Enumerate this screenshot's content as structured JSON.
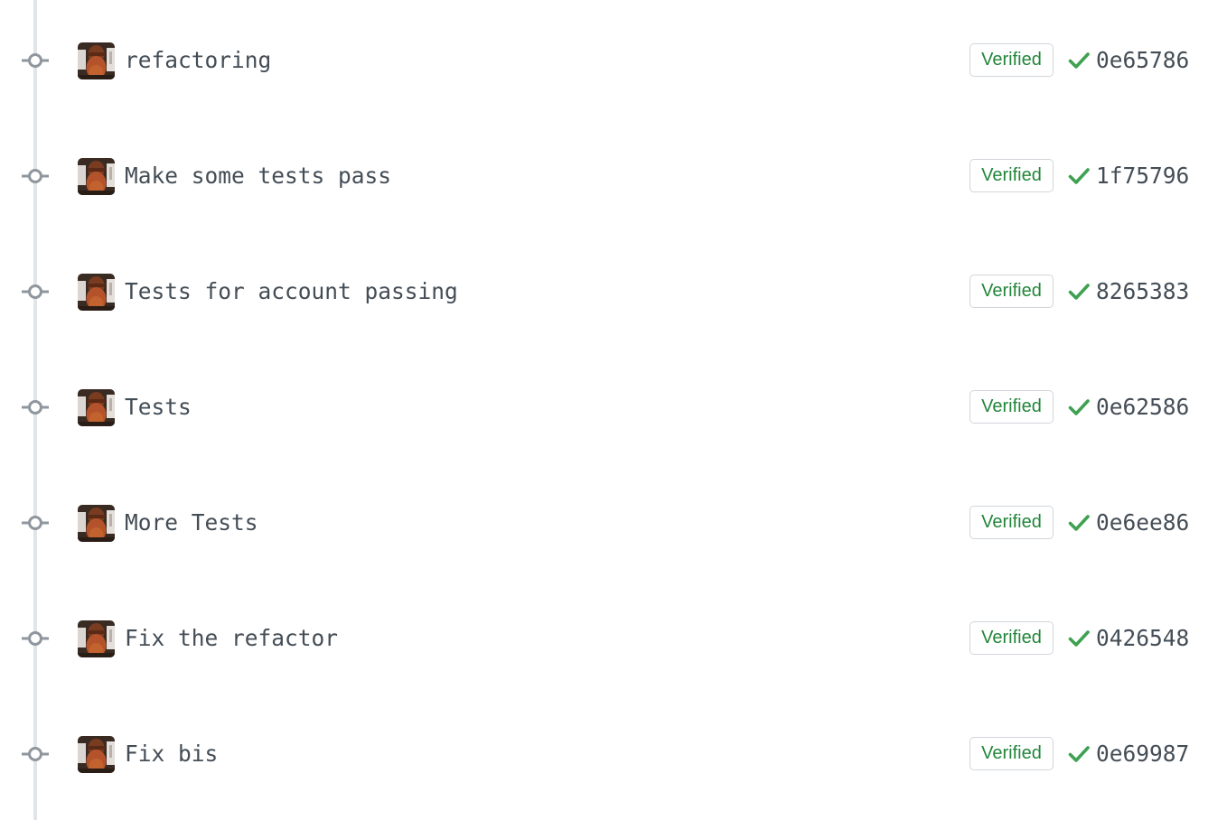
{
  "colors": {
    "verified_green": "#22863a",
    "check_green": "#3fa152",
    "text": "#444d56",
    "timeline": "#e1e4e8",
    "node": "#8f969e"
  },
  "commits": [
    {
      "message": "refactoring",
      "badge": "Verified",
      "status_icon": "check-icon",
      "sha": "0e65786"
    },
    {
      "message": "Make some tests pass",
      "badge": "Verified",
      "status_icon": "check-icon",
      "sha": "1f75796"
    },
    {
      "message": "Tests for account passing",
      "badge": "Verified",
      "status_icon": "check-icon",
      "sha": "8265383"
    },
    {
      "message": "Tests",
      "badge": "Verified",
      "status_icon": "check-icon",
      "sha": "0e62586"
    },
    {
      "message": "More Tests",
      "badge": "Verified",
      "status_icon": "check-icon",
      "sha": "0e6ee86"
    },
    {
      "message": "Fix the refactor",
      "badge": "Verified",
      "status_icon": "check-icon",
      "sha": "0426548"
    },
    {
      "message": "Fix bis",
      "badge": "Verified",
      "status_icon": "check-icon",
      "sha": "0e69987"
    }
  ]
}
